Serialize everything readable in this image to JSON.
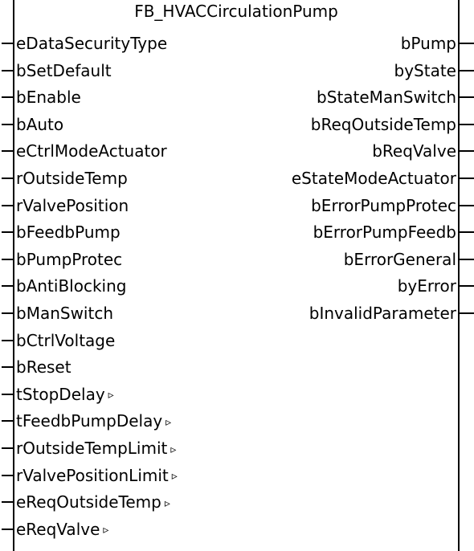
{
  "block": {
    "title": "FB_HVACCirculationPump"
  },
  "inputs": [
    {
      "label": "eDataSecurityType",
      "arrow": ""
    },
    {
      "label": "bSetDefault",
      "arrow": ""
    },
    {
      "label": "bEnable",
      "arrow": ""
    },
    {
      "label": "bAuto",
      "arrow": ""
    },
    {
      "label": "eCtrlModeActuator",
      "arrow": ""
    },
    {
      "label": "rOutsideTemp",
      "arrow": ""
    },
    {
      "label": "rValvePosition",
      "arrow": ""
    },
    {
      "label": "bFeedbPump",
      "arrow": ""
    },
    {
      "label": "bPumpProtec",
      "arrow": ""
    },
    {
      "label": "bAntiBlocking",
      "arrow": ""
    },
    {
      "label": "bManSwitch",
      "arrow": ""
    },
    {
      "label": "bCtrlVoltage",
      "arrow": ""
    },
    {
      "label": "bReset",
      "arrow": ""
    },
    {
      "label": "tStopDelay",
      "arrow": "▹"
    },
    {
      "label": "tFeedbPumpDelay",
      "arrow": "▹"
    },
    {
      "label": "rOutsideTempLimit",
      "arrow": "▹"
    },
    {
      "label": "rValvePositionLimit",
      "arrow": "▹"
    },
    {
      "label": "eReqOutsideTemp",
      "arrow": "▹"
    },
    {
      "label": "eReqValve",
      "arrow": "▹"
    }
  ],
  "outputs": [
    {
      "label": "bPump"
    },
    {
      "label": "byState"
    },
    {
      "label": "bStateManSwitch"
    },
    {
      "label": "bReqOutsideTemp"
    },
    {
      "label": "bReqValve"
    },
    {
      "label": "eStateModeActuator"
    },
    {
      "label": "bErrorPumpProtec"
    },
    {
      "label": "bErrorPumpFeedb"
    },
    {
      "label": "bErrorGeneral"
    },
    {
      "label": "byError"
    },
    {
      "label": "bInvalidParameter"
    }
  ]
}
